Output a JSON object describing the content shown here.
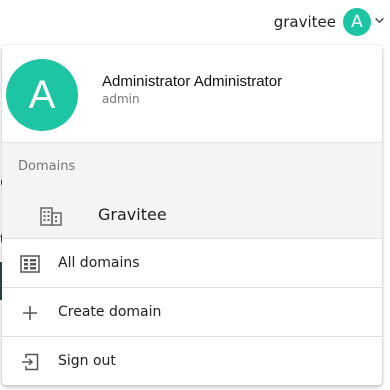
{
  "header": {
    "user_display_name": "gravitee",
    "avatar_initial": "A"
  },
  "background": {
    "fragment_1": "e",
    "fragment_2": "t"
  },
  "menu": {
    "avatar_initial": "A",
    "full_name": "Administrator Administrator",
    "username": "admin",
    "domains_section_label": "Domains",
    "domains": [
      {
        "label": "Gravitee",
        "icon": "building-icon"
      }
    ],
    "actions": [
      {
        "label": "All domains",
        "icon": "view-grid-icon"
      },
      {
        "label": "Create domain",
        "icon": "plus-icon"
      },
      {
        "label": "Sign out",
        "icon": "sign-out-icon"
      }
    ]
  },
  "colors": {
    "accent": "#1ec5a5",
    "section_bg": "#f4f4f4"
  }
}
